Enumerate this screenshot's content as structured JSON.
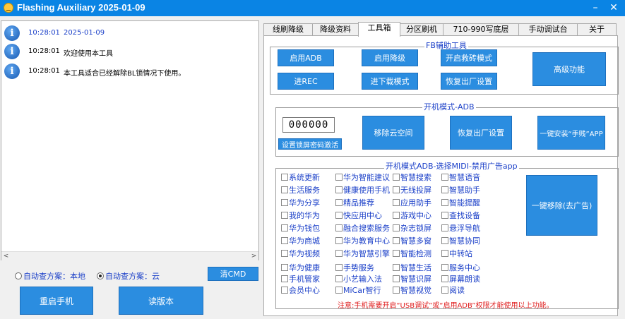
{
  "window": {
    "title": "Flashing Auxiliary 2025-01-09",
    "minimize": "–",
    "close": "✕"
  },
  "log": [
    {
      "time": "10:28:01",
      "message": "2025-01-09",
      "highlight": true
    },
    {
      "time": "10:28:01",
      "message": "欢迎使用本工具",
      "highlight": false
    },
    {
      "time": "10:28:01",
      "message": "本工具适合已经解除BL锁情况下使用。",
      "highlight": false
    }
  ],
  "scroll": {
    "left": "<",
    "right": ">"
  },
  "options": {
    "local": "自动查方案：本地",
    "cloud": "自动查方案：云",
    "cloud_selected": true
  },
  "buttons": {
    "clear_cmd": "清CMD",
    "reboot": "重启手机",
    "read_version": "读版本"
  },
  "tabs": [
    "线刷降级",
    "降级资料",
    "工具箱",
    "分区刷机",
    "710-990写底层",
    "手动调试台",
    "关于"
  ],
  "active_tab": 2,
  "fb_group": {
    "title": "FB辅助工具",
    "enable_adb": "启用ADB",
    "enable_downgrade": "启用降级",
    "enable_brick": "开启救砖模式",
    "enter_rec": "进REC",
    "enter_download": "进下载模式",
    "factory_reset": "恢复出厂设置",
    "advanced": "高级功能"
  },
  "adb_group": {
    "title": "开机模式-ADB",
    "pin_value": "000000",
    "set_pin": "设置锁屏密码激活",
    "remove_cloud": "移除云空间",
    "factory_reset": "恢复出厂设置",
    "install_app": "一键安装“手贱”APP"
  },
  "remove_group": {
    "title": "开机模式ADB-选择MIDI-禁用广告app",
    "remove_btn": "一键移除(去广告)",
    "columns": [
      [
        "系统更新",
        "生活服务",
        "华为分享",
        "我的华为",
        "华为钱包",
        "华为商城",
        "华为视频",
        "华为健康",
        "手机管家",
        "会员中心"
      ],
      [
        "华为智能建议",
        "健康使用手机",
        "精品推荐",
        "快应用中心",
        "融合搜索服务",
        "华为教育中心",
        "华为智慧引擎",
        "手势服务",
        "小艺输入法",
        "MiCar智行"
      ],
      [
        "智慧搜索",
        "无线投屏",
        "应用助手",
        "游戏中心",
        "杂志锁屏",
        "智慧多窗",
        "智能检测",
        "智慧生活",
        "智慧识屏",
        "智慧视觉"
      ],
      [
        "智慧语音",
        "智慧助手",
        "智能提醒",
        "查找设备",
        "悬浮导航",
        "智慧协同",
        "中转站",
        "服务中心",
        "屏幕朗读",
        "阅读"
      ]
    ]
  },
  "notice": "注意:手机需要开启“USB调试”或“启用ADB”权限才能使用以上功能。",
  "colors": {
    "titlebar": "#0a84e4",
    "button": "#2b8de0",
    "label": "#1a3fc8",
    "notice": "#e02020"
  }
}
